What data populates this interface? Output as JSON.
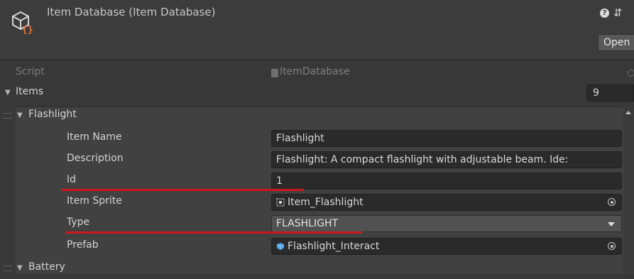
{
  "header": {
    "title": "Item Database (Item Database)",
    "help_icon": "?",
    "settings_icon": "⇵",
    "open_label": "Open"
  },
  "script": {
    "label": "Script",
    "value": "ItemDatabase"
  },
  "items": {
    "label": "Items",
    "count": "9"
  },
  "element": {
    "name": "Flashlight",
    "fields": {
      "item_name": {
        "label": "Item Name",
        "value": "Flashlight"
      },
      "description": {
        "label": "Description",
        "value": "Flashlight: A compact flashlight with adjustable beam. Ide:"
      },
      "id": {
        "label": "Id",
        "value": "1"
      },
      "item_sprite": {
        "label": "Item Sprite",
        "value": "Item_Flashlight"
      },
      "type": {
        "label": "Type",
        "value": "FLASHLIGHT"
      },
      "prefab": {
        "label": "Prefab",
        "value": "Flashlight_Interact"
      }
    }
  },
  "next_element": {
    "name": "Battery"
  },
  "colors": {
    "annotation": "#d0161c",
    "icon_orange": "#e8753a",
    "prefab_blue": "#4aa3e8"
  }
}
